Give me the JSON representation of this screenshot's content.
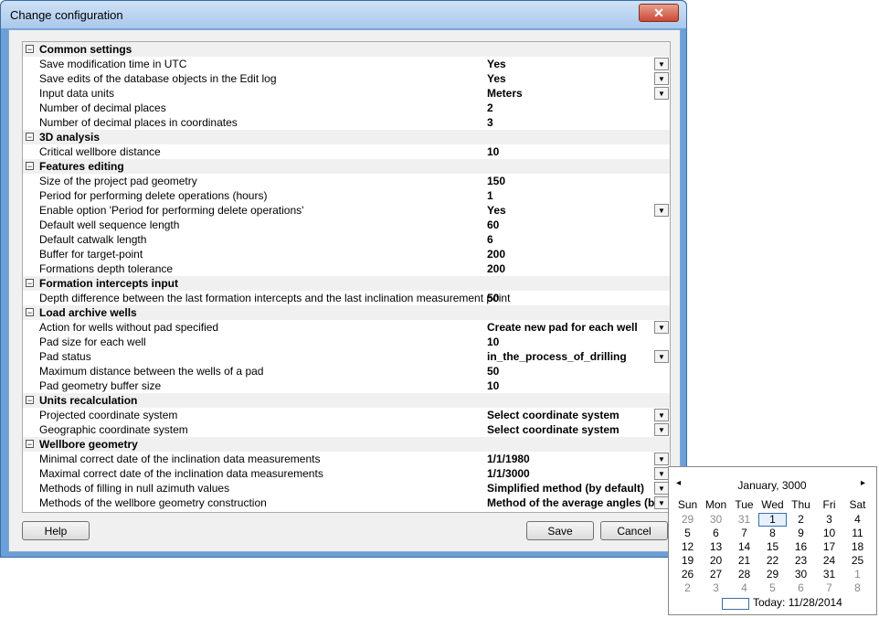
{
  "window": {
    "title": "Change configuration",
    "close_glyph": "✕"
  },
  "grid_rows": [
    {
      "type": "cat",
      "label": "Common settings"
    },
    {
      "type": "prop",
      "name": "Save modification time in UTC",
      "value": "Yes",
      "dropdown": true
    },
    {
      "type": "prop",
      "name": "Save edits of the database objects in the Edit log",
      "value": "Yes",
      "dropdown": true
    },
    {
      "type": "prop",
      "name": "Input data units",
      "value": "Meters",
      "dropdown": true
    },
    {
      "type": "prop",
      "name": "Number of decimal places",
      "value": "2",
      "dropdown": false
    },
    {
      "type": "prop",
      "name": "Number of decimal places in coordinates",
      "value": "3",
      "dropdown": false
    },
    {
      "type": "cat",
      "label": "3D analysis"
    },
    {
      "type": "prop",
      "name": "Critical wellbore distance",
      "value": "10",
      "dropdown": false
    },
    {
      "type": "cat",
      "label": "Features editing"
    },
    {
      "type": "prop",
      "name": "Size of the project pad geometry",
      "value": "150",
      "dropdown": false
    },
    {
      "type": "prop",
      "name": "Period for performing delete operations (hours)",
      "value": "1",
      "dropdown": false
    },
    {
      "type": "prop",
      "name": "Enable option 'Period for performing delete operations'",
      "value": "Yes",
      "dropdown": true
    },
    {
      "type": "prop",
      "name": "Default well sequence length",
      "value": "60",
      "dropdown": false
    },
    {
      "type": "prop",
      "name": "Default catwalk length",
      "value": "6",
      "dropdown": false
    },
    {
      "type": "prop",
      "name": "Buffer for target-point",
      "value": "200",
      "dropdown": false
    },
    {
      "type": "prop",
      "name": "Formations depth tolerance",
      "value": "200",
      "dropdown": false
    },
    {
      "type": "cat",
      "label": "Formation intercepts input"
    },
    {
      "type": "prop",
      "name": "Depth difference between the last formation intercepts and the last inclination measurement point",
      "value": "50",
      "dropdown": false
    },
    {
      "type": "cat",
      "label": "Load archive wells"
    },
    {
      "type": "prop",
      "name": "Action for wells without pad specified",
      "value": "Create new pad for each well",
      "dropdown": true
    },
    {
      "type": "prop",
      "name": "Pad size for each well",
      "value": "10",
      "dropdown": false
    },
    {
      "type": "prop",
      "name": "Pad status",
      "value": "in_the_process_of_drilling",
      "dropdown": true
    },
    {
      "type": "prop",
      "name": "Maximum distance between the wells of a pad",
      "value": "50",
      "dropdown": false
    },
    {
      "type": "prop",
      "name": "Pad geometry buffer size",
      "value": "10",
      "dropdown": false
    },
    {
      "type": "cat",
      "label": "Units recalculation"
    },
    {
      "type": "prop",
      "name": "Projected coordinate system",
      "value": "Select coordinate system",
      "dropdown": true
    },
    {
      "type": "prop",
      "name": "Geographic coordinate system",
      "value": "Select coordinate system",
      "dropdown": true
    },
    {
      "type": "cat",
      "label": "Wellbore geometry"
    },
    {
      "type": "prop",
      "name": "Minimal correct date of the inclination data measurements",
      "value": "1/1/1980",
      "dropdown": true
    },
    {
      "type": "prop",
      "name": "Maximal correct date of the inclination data measurements",
      "value": "1/1/3000",
      "dropdown": true
    },
    {
      "type": "prop",
      "name": "Methods of filling in null azimuth values",
      "value": "Simplified method (by default)",
      "dropdown": true
    },
    {
      "type": "prop",
      "name": "Methods of the wellbore geometry construction",
      "value": "Method of the average angles (by",
      "dropdown": true
    }
  ],
  "buttons": {
    "help": "Help",
    "save": "Save",
    "cancel": "Cancel"
  },
  "calendar": {
    "month_label": "January, 3000",
    "prev": "◂",
    "next": "▸",
    "dow": [
      "Sun",
      "Mon",
      "Tue",
      "Wed",
      "Thu",
      "Fri",
      "Sat"
    ],
    "weeks": [
      [
        {
          "d": "29",
          "dim": true
        },
        {
          "d": "30",
          "dim": true
        },
        {
          "d": "31",
          "dim": true
        },
        {
          "d": "1",
          "sel": true
        },
        {
          "d": "2"
        },
        {
          "d": "3"
        },
        {
          "d": "4"
        }
      ],
      [
        {
          "d": "5"
        },
        {
          "d": "6"
        },
        {
          "d": "7"
        },
        {
          "d": "8"
        },
        {
          "d": "9"
        },
        {
          "d": "10"
        },
        {
          "d": "11"
        }
      ],
      [
        {
          "d": "12"
        },
        {
          "d": "13"
        },
        {
          "d": "14"
        },
        {
          "d": "15"
        },
        {
          "d": "16"
        },
        {
          "d": "17"
        },
        {
          "d": "18"
        }
      ],
      [
        {
          "d": "19"
        },
        {
          "d": "20"
        },
        {
          "d": "21"
        },
        {
          "d": "22"
        },
        {
          "d": "23"
        },
        {
          "d": "24"
        },
        {
          "d": "25"
        }
      ],
      [
        {
          "d": "26"
        },
        {
          "d": "27"
        },
        {
          "d": "28"
        },
        {
          "d": "29"
        },
        {
          "d": "30"
        },
        {
          "d": "31"
        },
        {
          "d": "1",
          "dim": true
        }
      ],
      [
        {
          "d": "2",
          "dim": true
        },
        {
          "d": "3",
          "dim": true
        },
        {
          "d": "4",
          "dim": true
        },
        {
          "d": "5",
          "dim": true
        },
        {
          "d": "6",
          "dim": true
        },
        {
          "d": "7",
          "dim": true
        },
        {
          "d": "8",
          "dim": true
        }
      ]
    ],
    "today_label": "Today: 11/28/2014"
  },
  "icons": {
    "expander": "minus-box-icon",
    "dropdown": "chevron-down-icon"
  }
}
